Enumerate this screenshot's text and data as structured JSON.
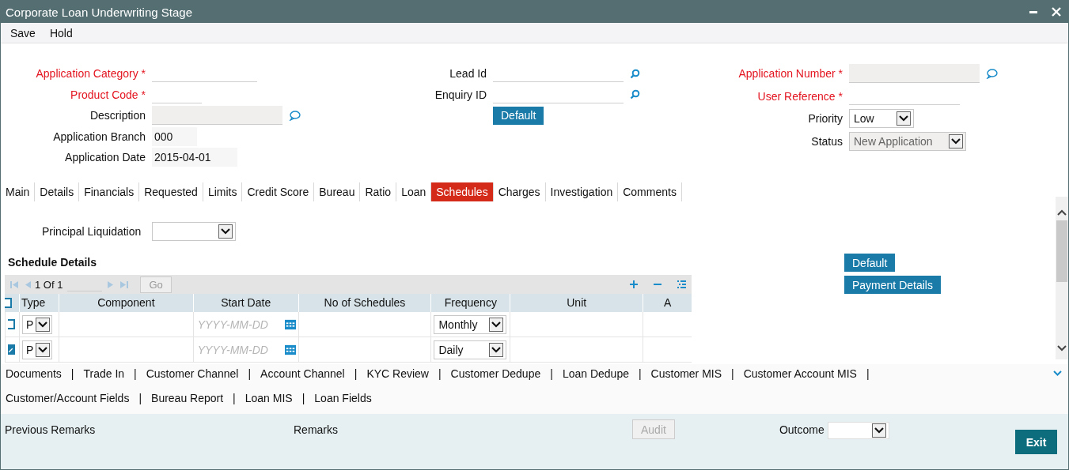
{
  "window": {
    "title": "Corporate Loan Underwriting Stage"
  },
  "menu": [
    "Save",
    "Hold"
  ],
  "required_mark": "*",
  "form_columns": [
    {
      "fields": [
        {
          "label": "Application Category",
          "required": true,
          "kind": "underline"
        },
        {
          "label": "Product Code",
          "required": true,
          "kind": "underline"
        },
        {
          "label": "Description",
          "required": false,
          "kind": "remark"
        },
        {
          "label": "Application Branch",
          "required": false,
          "kind": "value",
          "value": "000"
        },
        {
          "label": "Application Date",
          "required": false,
          "kind": "value",
          "value": "2015-04-01"
        }
      ]
    },
    {
      "fields": [
        {
          "label": "Lead Id",
          "required": false,
          "kind": "lookup"
        },
        {
          "label": "Enquiry ID",
          "required": false,
          "kind": "lookup"
        },
        {
          "kind": "button",
          "text": "Default"
        }
      ]
    },
    {
      "fields": [
        {
          "label": "Application Number",
          "required": true,
          "kind": "remark"
        },
        {
          "label": "User Reference",
          "required": true,
          "kind": "underline"
        },
        {
          "label": "Priority",
          "required": false,
          "kind": "select",
          "value": "Low",
          "disabled": false
        },
        {
          "label": "Status",
          "required": false,
          "kind": "select",
          "value": "New Application",
          "disabled": true
        }
      ]
    }
  ],
  "tabs": [
    {
      "label": "Main",
      "selected": false
    },
    {
      "label": "Details",
      "selected": false
    },
    {
      "label": "Financials",
      "selected": false
    },
    {
      "label": "Requested",
      "selected": false
    },
    {
      "label": "Limits",
      "selected": false
    },
    {
      "label": "Credit Score",
      "selected": false
    },
    {
      "label": "Bureau",
      "selected": false
    },
    {
      "label": "Ratio",
      "selected": false
    },
    {
      "label": "Loan",
      "selected": false
    },
    {
      "label": "Schedules",
      "selected": true
    },
    {
      "label": "Charges",
      "selected": false
    },
    {
      "label": "Investigation",
      "selected": false
    },
    {
      "label": "Comments",
      "selected": false
    }
  ],
  "principal_liquidation": {
    "label": "Principal Liquidation"
  },
  "schedule_details": {
    "title": "Schedule Details",
    "page": "1 Of 1",
    "go": "Go",
    "header_checked": false,
    "columns": [
      "Type",
      "Component",
      "Start Date",
      "No of Schedules",
      "Frequency",
      "Unit",
      "A"
    ],
    "rows": [
      {
        "checked": false,
        "type": "P",
        "start_date_placeholder": "YYYY-MM-DD",
        "frequency": "Monthly"
      },
      {
        "checked": true,
        "type": "P",
        "start_date_placeholder": "YYYY-MM-DD",
        "frequency": "Daily"
      }
    ]
  },
  "side_buttons": [
    "Default",
    "Payment Details"
  ],
  "link_separator": "|",
  "links": [
    "Documents",
    "Trade In",
    "Customer Channel",
    "Account Channel",
    "KYC Review",
    "Customer Dedupe",
    "Loan Dedupe",
    "Customer MIS",
    "Customer Account MIS",
    "Customer/Account Fields",
    "Bureau Report",
    "Loan MIS",
    "Loan Fields"
  ],
  "footer": {
    "previous_remarks": "Previous Remarks",
    "remarks": "Remarks",
    "audit": "Audit",
    "audit_disabled": true,
    "outcome": "Outcome",
    "exit": "Exit"
  }
}
